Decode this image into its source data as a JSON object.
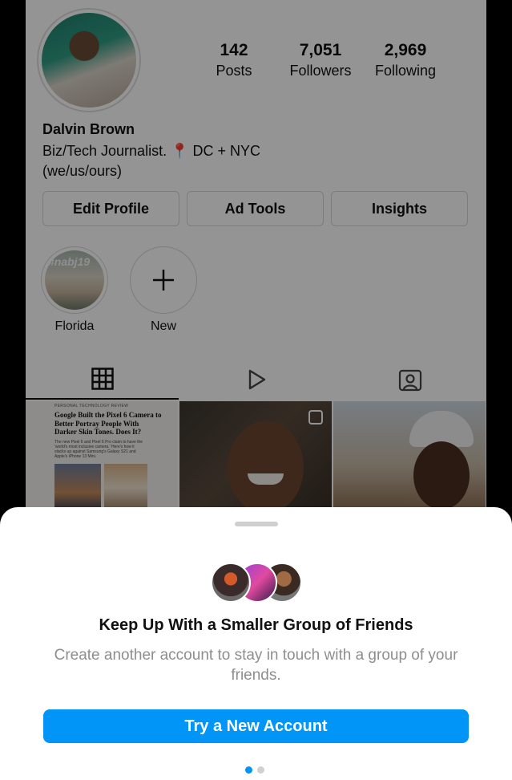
{
  "profile": {
    "name": "Dalvin Brown",
    "bio_line1_a": "Biz/Tech Journalist.",
    "bio_pin": "📍",
    "bio_line1_b": "DC + NYC",
    "bio_line2": "(we/us/ours)",
    "stats": [
      {
        "value": "142",
        "label": "Posts"
      },
      {
        "value": "7,051",
        "label": "Followers"
      },
      {
        "value": "2,969",
        "label": "Following"
      }
    ]
  },
  "actions": {
    "edit_profile": "Edit Profile",
    "ad_tools": "Ad Tools",
    "insights": "Insights"
  },
  "highlights": [
    {
      "label": "Florida",
      "cover_text": "#nabj19"
    },
    {
      "label": "New"
    }
  ],
  "tabs": [
    "grid-icon",
    "reels-icon",
    "tagged-icon"
  ],
  "posts": [
    {
      "kicker": "PERSONAL TECHNOLOGY REVIEW",
      "title": "Google Built the Pixel 6 Camera to Better Portray People With Darker Skin Tones. Does It?",
      "body": "The new Pixel 6 and Pixel 6 Pro claim to have the 'world's most inclusive camera.' Here's how it stacks up against Samsung's Galaxy S21 and Apple's iPhone 13 Mini."
    },
    {},
    {}
  ],
  "sheet": {
    "title": "Keep Up With a Smaller Group of Friends",
    "body": "Create another account to stay in touch with a group of your friends.",
    "cta": "Try a New Account",
    "page_index": 1,
    "page_count": 2
  },
  "colors": {
    "accent": "#0095f6",
    "muted_text": "#8e8e8e",
    "overlay": "rgba(0,0,0,0.42)"
  }
}
